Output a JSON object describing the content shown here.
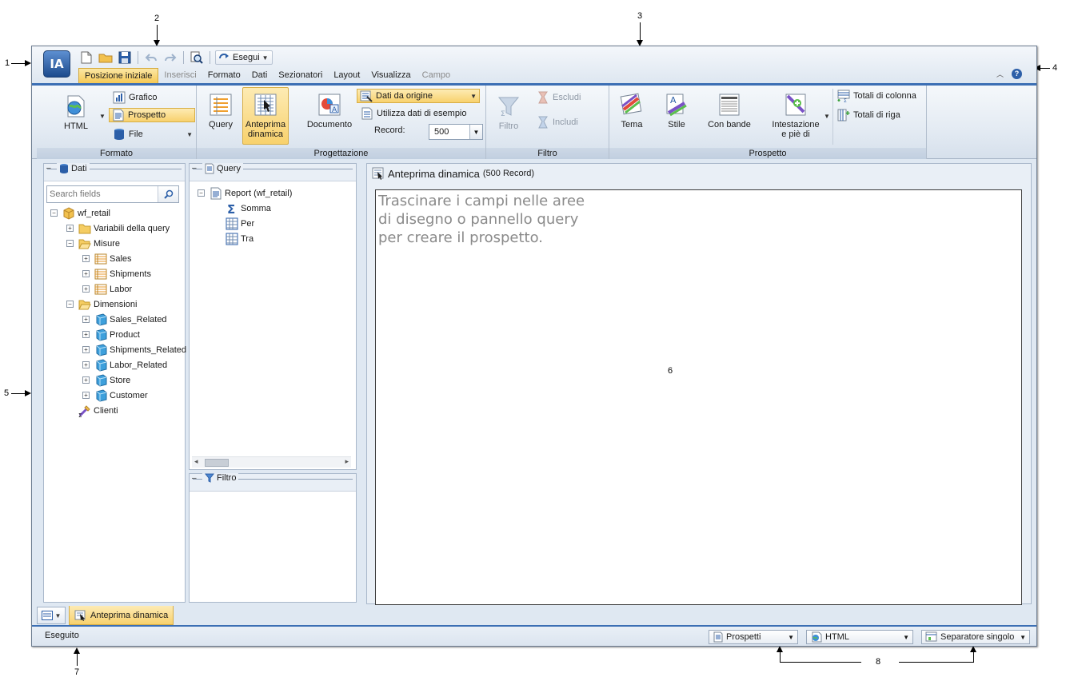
{
  "callouts": [
    "1",
    "2",
    "3",
    "4",
    "5",
    "6",
    "7",
    "8"
  ],
  "app": {
    "logo_text": "IA",
    "run_label": "Esegui",
    "menu_tabs": [
      "Posizione iniziale",
      "Inserisci",
      "Formato",
      "Dati",
      "Sezionatori",
      "Layout",
      "Visualizza",
      "Campo"
    ]
  },
  "ribbon": {
    "formato": {
      "label": "Formato",
      "html": "HTML",
      "grafico": "Grafico",
      "prospetto": "Prospetto",
      "file": "File"
    },
    "progettazione": {
      "label": "Progettazione",
      "query": "Query",
      "anteprima_l1": "Anteprima",
      "anteprima_l2": "dinamica",
      "documento": "Documento",
      "dati_origine": "Dati da origine",
      "utilizza": "Utilizza dati di esempio",
      "record_label": "Record:",
      "record_value": "500"
    },
    "filtro": {
      "label": "Filtro",
      "filtro": "Filtro",
      "escludi": "Escludi",
      "includi": "Includi"
    },
    "prospetto": {
      "label": "Prospetto",
      "tema": "Tema",
      "stile": "Stile",
      "con_bande": "Con bande",
      "intestazione_l1": "Intestazione",
      "intestazione_l2": "e piè di",
      "totali_colonna": "Totali di colonna",
      "totali_riga": "Totali di riga"
    }
  },
  "data_panel": {
    "title": "Dati",
    "search_placeholder": "Search fields",
    "tree": [
      {
        "label": "wf_retail",
        "level": 0,
        "exp": "minus",
        "icon": "cube"
      },
      {
        "label": "Variabili della query",
        "level": 1,
        "exp": "plus",
        "icon": "folder"
      },
      {
        "label": "Misure",
        "level": 1,
        "exp": "minus",
        "icon": "folder-open"
      },
      {
        "label": "Sales",
        "level": 2,
        "exp": "plus",
        "icon": "measure"
      },
      {
        "label": "Shipments",
        "level": 2,
        "exp": "plus",
        "icon": "measure"
      },
      {
        "label": "Labor",
        "level": 2,
        "exp": "plus",
        "icon": "measure"
      },
      {
        "label": "Dimensioni",
        "level": 1,
        "exp": "minus",
        "icon": "folder-open"
      },
      {
        "label": "Sales_Related",
        "level": 2,
        "exp": "plus",
        "icon": "dimension"
      },
      {
        "label": "Product",
        "level": 2,
        "exp": "plus",
        "icon": "dimension"
      },
      {
        "label": "Shipments_Related",
        "level": 2,
        "exp": "plus",
        "icon": "dimension"
      },
      {
        "label": "Labor_Related",
        "level": 2,
        "exp": "plus",
        "icon": "dimension"
      },
      {
        "label": "Store",
        "level": 2,
        "exp": "plus",
        "icon": "dimension"
      },
      {
        "label": "Customer",
        "level": 2,
        "exp": "plus",
        "icon": "dimension"
      },
      {
        "label": "Clienti",
        "level": 1,
        "exp": "none",
        "icon": "tools"
      }
    ]
  },
  "query_panel": {
    "title": "Query",
    "tree": [
      {
        "label": "Report (wf_retail)",
        "level": 0,
        "exp": "minus",
        "icon": "report"
      },
      {
        "label": "Somma",
        "level": 1,
        "exp": "none",
        "icon": "sigma"
      },
      {
        "label": "Per",
        "level": 1,
        "exp": "none",
        "icon": "grid"
      },
      {
        "label": "Tra",
        "level": 1,
        "exp": "none",
        "icon": "grid"
      }
    ]
  },
  "filter_panel": {
    "title": "Filtro"
  },
  "preview": {
    "title": "Anteprima dinamica",
    "subtitle": "(500 Record)",
    "placeholder": "Trascinare i campi nelle aree di disegno o pannello query per creare il prospetto."
  },
  "bottom_tab": "Anteprima dinamica",
  "status": {
    "text": "Eseguito",
    "dd1": "Prospetti",
    "dd2": "HTML",
    "dd3": "Separatore singolo"
  },
  "colors": {
    "accent_blue": "#3c6fb4",
    "selected_orange": "#f8d16d"
  }
}
